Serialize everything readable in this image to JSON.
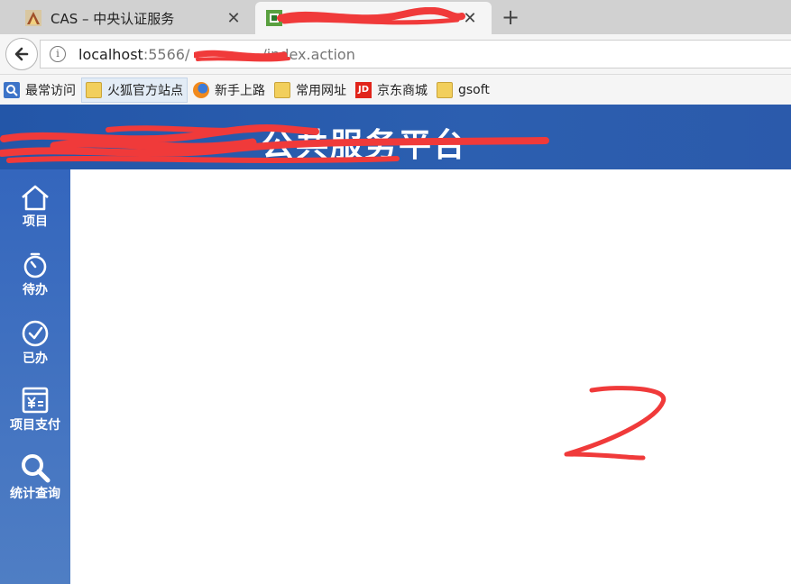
{
  "browser": {
    "tabs": [
      {
        "title": "CAS – 中央认证服务",
        "active": false
      },
      {
        "title": "",
        "active": true
      }
    ],
    "new_tab_symbol": "+",
    "close_symbol": "✕",
    "url": {
      "host": "localhost",
      "rest_visible": ":5566/",
      "path_end": "/index.action"
    },
    "bookmarks": [
      {
        "label": "最常访问",
        "icon": "search-icon"
      },
      {
        "label": "火狐官方站点",
        "icon": "folder-icon"
      },
      {
        "label": "新手上路",
        "icon": "firefox-icon"
      },
      {
        "label": "常用网址",
        "icon": "folder-icon"
      },
      {
        "label": "京东商城",
        "icon": "jd-icon"
      },
      {
        "label": "gsoft",
        "icon": "folder-icon"
      }
    ]
  },
  "app": {
    "title_visible": "公共服务平台",
    "nav": [
      {
        "label": "项目",
        "icon": "home-icon"
      },
      {
        "label": "待办",
        "icon": "timer-icon"
      },
      {
        "label": "已办",
        "icon": "check-circle-icon"
      },
      {
        "label": "项目支付",
        "icon": "payment-icon"
      },
      {
        "label": "统计查询",
        "icon": "search-icon"
      }
    ]
  },
  "annotation": {
    "color": "#f03a3a",
    "text": "2"
  },
  "colors": {
    "header": "#2356a8",
    "sidebar": "#3466bd",
    "redaction": "#f03a3a"
  }
}
